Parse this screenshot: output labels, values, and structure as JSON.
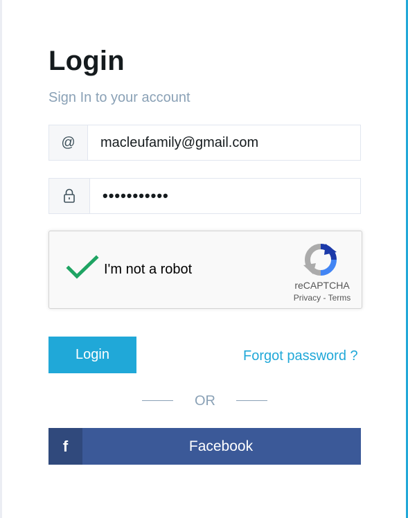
{
  "login": {
    "title": "Login",
    "subtitle": "Sign In to your account",
    "email": {
      "icon": "at-sign-icon",
      "symbol": "@",
      "value": "macleufamily@gmail.com"
    },
    "password": {
      "icon": "lock-icon",
      "value": "•••••••••••"
    },
    "captcha": {
      "label": "I'm not a robot",
      "checked": true,
      "brand": "reCAPTCHA",
      "privacy": "Privacy",
      "separator": " - ",
      "terms": "Terms"
    },
    "submit_label": "Login",
    "forgot_label": "Forgot password ?",
    "or_label": "OR",
    "facebook": {
      "icon_letter": "f",
      "label": "Facebook"
    }
  },
  "colors": {
    "accent": "#20a8d8",
    "facebook": "#3b5998",
    "facebook_icon_bg": "#30497c",
    "muted": "#8aa1b6",
    "check_green": "#1fa463"
  }
}
